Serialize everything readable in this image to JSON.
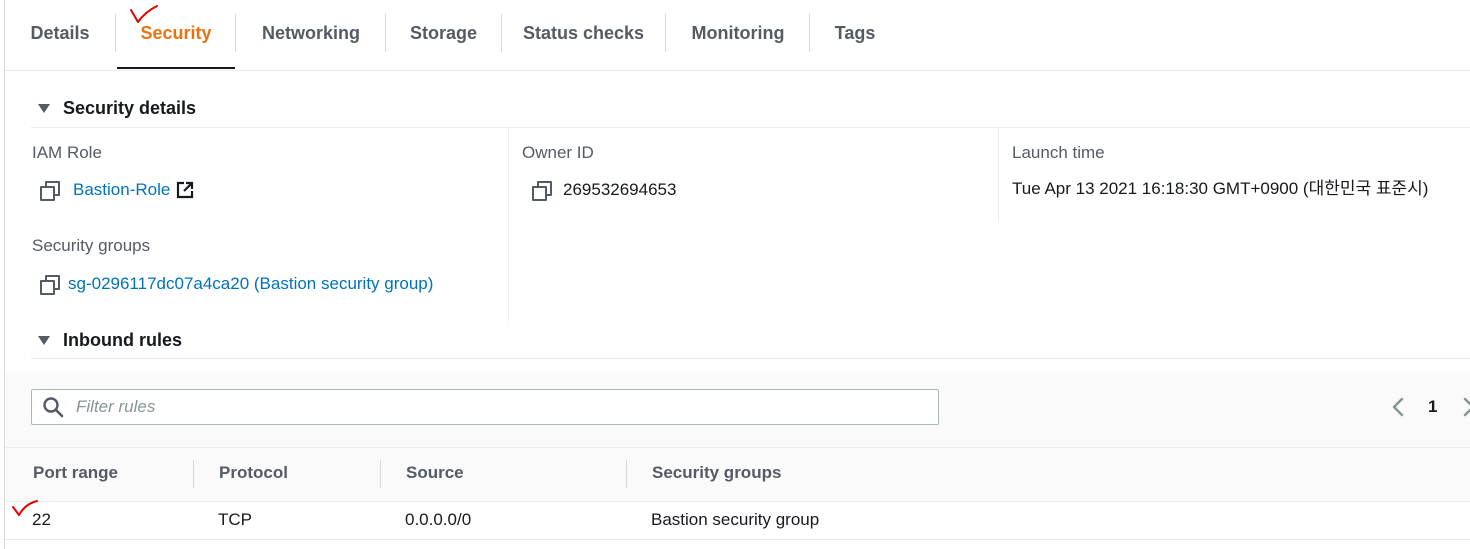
{
  "tabs": [
    {
      "label": "Details"
    },
    {
      "label": "Security"
    },
    {
      "label": "Networking"
    },
    {
      "label": "Storage"
    },
    {
      "label": "Status checks"
    },
    {
      "label": "Monitoring"
    },
    {
      "label": "Tags"
    }
  ],
  "active_tab": "Security",
  "security_details": {
    "title": "Security details",
    "iam_role": {
      "label": "IAM Role",
      "value": "Bastion-Role"
    },
    "owner_id": {
      "label": "Owner ID",
      "value": "269532694653"
    },
    "launch_time": {
      "label": "Launch time",
      "value": "Tue Apr 13 2021 16:18:30 GMT+0900 (대한민국 표준시)"
    },
    "security_groups": {
      "label": "Security groups",
      "value": "sg-0296117dc07a4ca20 (Bastion security group)"
    }
  },
  "inbound_rules": {
    "title": "Inbound rules",
    "filter_placeholder": "Filter rules",
    "page": "1",
    "columns": [
      "Port range",
      "Protocol",
      "Source",
      "Security groups"
    ],
    "rows": [
      [
        "22",
        "TCP",
        "0.0.0.0/0",
        "Bastion security group"
      ]
    ]
  },
  "colors": {
    "active_tab": "#ec7211",
    "link": "#0073bb",
    "annotation_mark": "#e60000"
  },
  "icons": {
    "copy": "copy-icon",
    "external_link": "external-link-icon",
    "search": "search-icon",
    "caret": "caret-down-icon"
  }
}
